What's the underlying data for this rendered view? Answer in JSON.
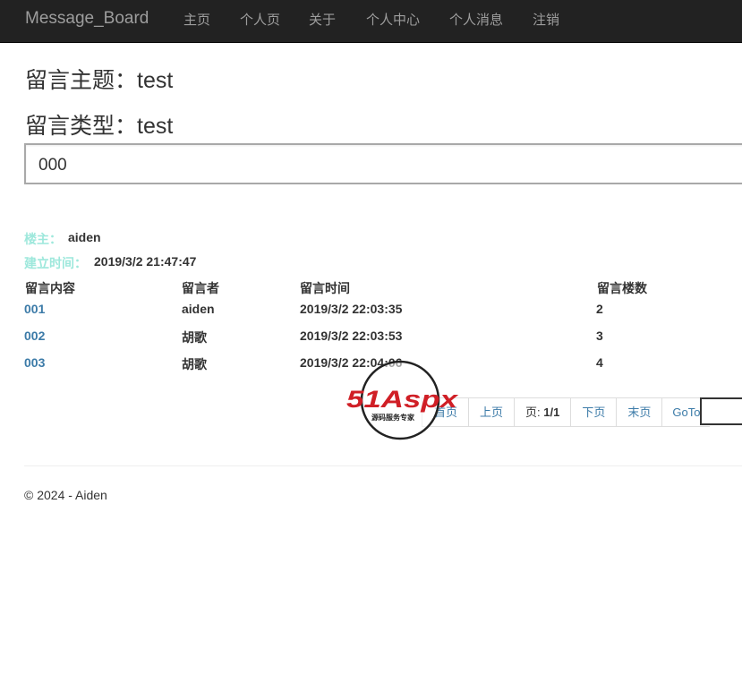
{
  "navbar": {
    "brand": "Message_Board",
    "links": [
      "主页",
      "个人页",
      "关于",
      "个人中心",
      "个人消息",
      "注销"
    ]
  },
  "post": {
    "subject_label": "留言主题：",
    "subject": "test",
    "type_label": "留言类型：",
    "type": "test",
    "content": "000",
    "owner_label": "楼主：",
    "owner": "aiden",
    "created_label": "建立时间：",
    "created": "2019/3/2 21:47:47"
  },
  "table": {
    "headers": [
      "留言内容",
      "留言者",
      "留言时间",
      "留言楼数"
    ],
    "rows": [
      {
        "content": "001",
        "author": "aiden",
        "time": "2019/3/2 22:03:35",
        "floor": "2"
      },
      {
        "content": "002",
        "author": "胡歌",
        "time": "2019/3/2 22:03:53",
        "floor": "3"
      },
      {
        "content": "003",
        "author": "胡歌",
        "time": "2019/3/2 22:04:06",
        "floor": "4"
      }
    ]
  },
  "pager": {
    "first": "首页",
    "prev": "上页",
    "page_label": "页: ",
    "page_value": "1/1",
    "next": "下页",
    "last": "末页",
    "goto": "GoTo"
  },
  "footer": {
    "text": "© 2024 - Aiden"
  },
  "watermark": {
    "logo_text": "51Aspx",
    "tagline": "源码服务专家"
  },
  "colors": {
    "navbar_bg": "#222222",
    "nav_text": "#9d9d9d",
    "link": "#3c7ba8",
    "meta_label": "#9ee8dc",
    "watermark_red": "#d01f26",
    "watermark_green": "#3a9b2f"
  }
}
